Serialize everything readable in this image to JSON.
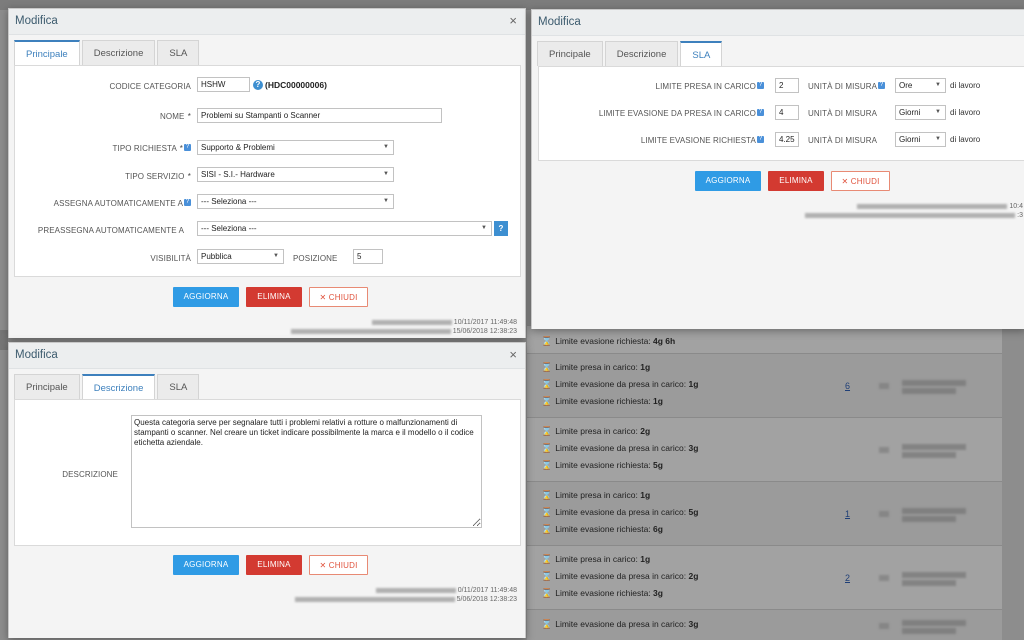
{
  "background": {
    "rows": [
      {
        "lines": [
          {
            "label": "Limite evasione richiesta:",
            "value": "4g 6h"
          }
        ],
        "num": ""
      },
      {
        "lines": [
          {
            "label": "Limite presa in carico:",
            "value": "1g"
          },
          {
            "label": "Limite evasione da presa in carico:",
            "value": "1g"
          },
          {
            "label": "Limite evasione richiesta:",
            "value": "1g"
          }
        ],
        "num": "6"
      },
      {
        "lines": [
          {
            "label": "Limite presa in carico:",
            "value": "2g"
          },
          {
            "label": "Limite evasione da presa in carico:",
            "value": "3g"
          },
          {
            "label": "Limite evasione richiesta:",
            "value": "5g"
          }
        ],
        "num": ""
      },
      {
        "lines": [
          {
            "label": "Limite presa in carico:",
            "value": "1g"
          },
          {
            "label": "Limite evasione da presa in carico:",
            "value": "5g"
          },
          {
            "label": "Limite evasione richiesta:",
            "value": "6g"
          }
        ],
        "num": "1"
      },
      {
        "lines": [
          {
            "label": "Limite presa in carico:",
            "value": "1g"
          },
          {
            "label": "Limite evasione da presa in carico:",
            "value": "2g"
          },
          {
            "label": "Limite evasione richiesta:",
            "value": "3g"
          }
        ],
        "num": "2"
      },
      {
        "lines": [
          {
            "label": "Limite evasione da presa in carico:",
            "value": "3g"
          }
        ],
        "num": ""
      }
    ]
  },
  "modal_principale": {
    "title": "Modifica",
    "close": "×",
    "tabs": [
      "Principale",
      "Descrizione",
      "SLA"
    ],
    "codice_label": "CODICE CATEGORIA",
    "codice_value": "HSHW",
    "codice_extra": "(HDC00000006)",
    "nome_label": "NOME",
    "nome_value": "Problemi su  Stampanti o Scanner",
    "tipo_richiesta_label": "TIPO RICHIESTA",
    "tipo_richiesta_value": "Supporto & Problemi",
    "tipo_servizio_label": "TIPO SERVIZIO",
    "tipo_servizio_value": "SISI - S.I.- Hardware",
    "assegna_label": "ASSEGNA AUTOMATICAMENTE A",
    "assegna_value": "--- Seleziona ---",
    "preassegna_label": "PREASSEGNA AUTOMATICAMENTE A",
    "preassegna_value": "--- Seleziona ---",
    "visibilita_label": "VISIBILITÀ",
    "visibilita_value": "Pubblica",
    "posizione_label": "POSIZIONE",
    "posizione_value": "5",
    "req": "*",
    "help": "?",
    "btn_aggiorna": "AGGIORNA",
    "btn_elimina": "ELIMINA",
    "btn_chiudi": "✕ CHIUDI",
    "meta1": "10/11/2017 11:49:48",
    "meta2": "15/06/2018 12:38:23"
  },
  "modal_sla": {
    "title": "Modifica",
    "tabs": [
      "Principale",
      "Descrizione",
      "SLA"
    ],
    "rows": [
      {
        "label": "LIMITE PRESA IN CARICO",
        "value": "2",
        "unit_label": "UNITÀ DI MISURA",
        "unit_value": "Ore",
        "suffix": "di lavoro"
      },
      {
        "label": "LIMITE EVASIONE DA PRESA IN CARICO",
        "value": "4",
        "unit_label": "UNITÀ DI MISURA",
        "unit_value": "Giorni",
        "suffix": "di lavoro"
      },
      {
        "label": "LIMITE EVASIONE RICHIESTA",
        "value": "4.25",
        "unit_label": "UNITÀ DI MISURA",
        "unit_value": "Giorni",
        "suffix": "di lavoro"
      }
    ],
    "help": "?",
    "btn_aggiorna": "AGGIORNA",
    "btn_elimina": "ELIMINA",
    "btn_chiudi": "✕ CHIUDI",
    "meta1": "10:4",
    "meta2": ":3"
  },
  "modal_descrizione": {
    "title": "Modifica",
    "close": "×",
    "tabs": [
      "Principale",
      "Descrizione",
      "SLA"
    ],
    "descrizione_label": "DESCRIZIONE",
    "descrizione_value": "Questa categoria serve per segnalare tutti i problemi relativi a rotture o malfunzionamenti di stampanti o scanner. Nel creare un ticket indicare possibilmente la marca e il modello o il codice etichetta aziendale.",
    "btn_aggiorna": "AGGIORNA",
    "btn_elimina": "ELIMINA",
    "btn_chiudi": "✕ CHIUDI",
    "meta1": "0/11/2017 11:49:48",
    "meta2": "5/06/2018 12:38:23"
  }
}
